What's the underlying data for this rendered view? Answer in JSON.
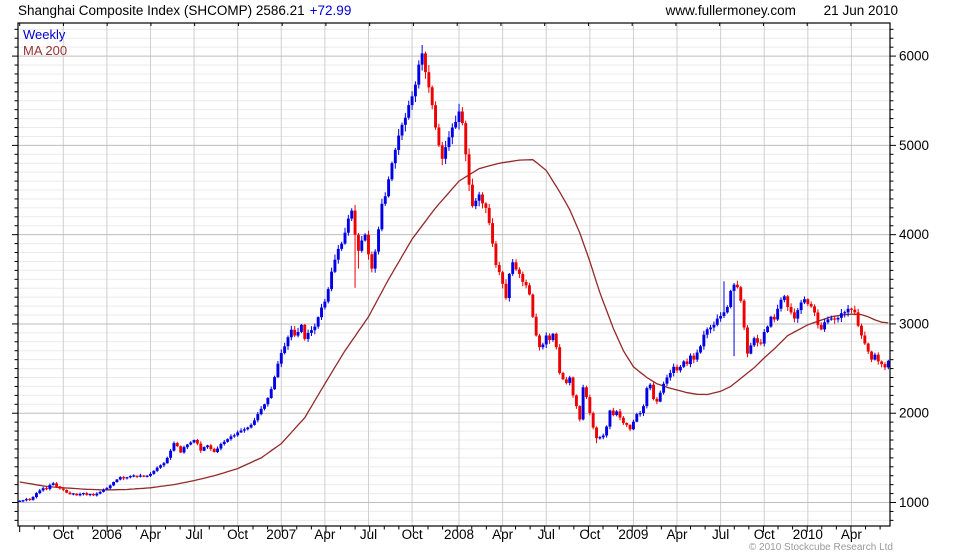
{
  "header": {
    "title_left": "Shanghai Composite Index (SHCOMP) 2586.21",
    "change": "+72.99",
    "website": "www.fullermoney.com",
    "date": "21 Jun 2010"
  },
  "legend": {
    "timeframe": "Weekly",
    "ma": "MA 200"
  },
  "footer": {
    "copyright": "© 2010 Stockcube Research Ltd"
  },
  "chart_data": {
    "type": "candlestick",
    "title": "Shanghai Composite Index (SHCOMP)",
    "timeframe": "Weekly",
    "overlay": "MA 200",
    "last_price": 2586.21,
    "change": 72.99,
    "grid": "on",
    "y_axis": {
      "side": "right",
      "min": 737,
      "max": 6370,
      "minor_step": 100,
      "ticks": [
        {
          "v": 1000,
          "label": "1000"
        },
        {
          "v": 2000,
          "label": "2000"
        },
        {
          "v": 3000,
          "label": "3000"
        },
        {
          "v": 4000,
          "label": "4000"
        },
        {
          "v": 5000,
          "label": "5000"
        },
        {
          "v": 6000,
          "label": "6000"
        }
      ]
    },
    "x_axis": {
      "unit": "week",
      "start": "Jul 2005",
      "end": "Jun 2010",
      "weeks_total": 260,
      "labels": [
        {
          "label": "Oct",
          "week": 13
        },
        {
          "label": "2006",
          "week": 26
        },
        {
          "label": "Apr",
          "week": 39
        },
        {
          "label": "Jul",
          "week": 52
        },
        {
          "label": "Oct",
          "week": 65
        },
        {
          "label": "2007",
          "week": 78
        },
        {
          "label": "Apr",
          "week": 91
        },
        {
          "label": "Jul",
          "week": 104
        },
        {
          "label": "Oct",
          "week": 117
        },
        {
          "label": "2008",
          "week": 131
        },
        {
          "label": "Apr",
          "week": 144
        },
        {
          "label": "Jul",
          "week": 157
        },
        {
          "label": "Oct",
          "week": 170
        },
        {
          "label": "2009",
          "week": 183
        },
        {
          "label": "Apr",
          "week": 196
        },
        {
          "label": "Jul",
          "week": 209
        },
        {
          "label": "Oct",
          "week": 222
        },
        {
          "label": "2010",
          "week": 235
        },
        {
          "label": "Apr",
          "week": 248
        }
      ]
    },
    "weekly_closes": [
      1012,
      1025,
      1038,
      1030,
      1060,
      1105,
      1135,
      1160,
      1150,
      1195,
      1215,
      1180,
      1155,
      1141,
      1110,
      1092,
      1100,
      1080,
      1095,
      1105,
      1085,
      1095,
      1080,
      1100,
      1120,
      1145,
      1161,
      1192,
      1230,
      1258,
      1285,
      1270,
      1283,
      1295,
      1299,
      1288,
      1302,
      1290,
      1298,
      1320,
      1355,
      1390,
      1417,
      1440,
      1500,
      1580,
      1665,
      1630,
      1560,
      1620,
      1650,
      1672,
      1700,
      1660,
      1580,
      1620,
      1640,
      1600,
      1565,
      1605,
      1655,
      1680,
      1710,
      1740,
      1752,
      1785,
      1805,
      1820,
      1840,
      1870,
      1920,
      1990,
      2050,
      2100,
      2170,
      2270,
      2405,
      2555,
      2675,
      2750,
      2850,
      2935,
      2870,
      2910,
      2990,
      2832,
      2900,
      2930,
      2970,
      3075,
      3184,
      3250,
      3390,
      3585,
      3720,
      3841,
      3900,
      4022,
      4180,
      4270,
      4000,
      3820,
      3935,
      4000,
      3780,
      3620,
      3810,
      4060,
      4346,
      4430,
      4620,
      4800,
      4950,
      5110,
      5230,
      5310,
      5450,
      5550,
      5680,
      5905,
      6030,
      5820,
      5650,
      5450,
      5200,
      5000,
      4850,
      4980,
      5090,
      5200,
      5262,
      5380,
      5250,
      4900,
      4560,
      4320,
      4380,
      4450,
      4350,
      4300,
      4130,
      3900,
      3660,
      3580,
      3450,
      3290,
      3560,
      3690,
      3610,
      3560,
      3470,
      3433,
      3330,
      3080,
      2870,
      2740,
      2770,
      2870,
      2820,
      2890,
      2740,
      2450,
      2380,
      2340,
      2400,
      2200,
      2080,
      1930,
      2290,
      2180,
      2000,
      1840,
      1720,
      1730,
      1750,
      1850,
      2030,
      1980,
      2020,
      1950,
      1890,
      1870,
      1820,
      1905,
      1990,
      2000,
      2080,
      2280,
      2320,
      2160,
      2130,
      2230,
      2330,
      2400,
      2450,
      2520,
      2480,
      2520,
      2580,
      2550,
      2645,
      2600,
      2680,
      2750,
      2880,
      2940,
      2960,
      2990,
      3060,
      3090,
      3130,
      3190,
      3370,
      3440,
      3412,
      3260,
      2960,
      2668,
      2760,
      2840,
      2790,
      2780,
      2910,
      2970,
      3080,
      3050,
      3170,
      3270,
      3310,
      3190,
      3130,
      3060,
      3155,
      3240,
      3277,
      3224,
      3196,
      3128,
      2989,
      2939,
      3018,
      3051,
      3060,
      3050,
      3068,
      3120,
      3130,
      3170,
      3160,
      3130,
      2980,
      2870,
      2780,
      2690,
      2600,
      2655,
      2580,
      2550,
      2513,
      2586
    ],
    "wick_overrides": {
      "100": {
        "low": 3404
      },
      "101": {
        "low": 3620
      },
      "120": {
        "high": 6124
      },
      "172": {
        "low": 1664
      },
      "210": {
        "high": 3478
      },
      "213": {
        "low": 2639
      }
    },
    "ma200_points": [
      [
        0,
        1230
      ],
      [
        8,
        1180
      ],
      [
        13,
        1165
      ],
      [
        20,
        1148
      ],
      [
        26,
        1140
      ],
      [
        32,
        1146
      ],
      [
        39,
        1165
      ],
      [
        46,
        1200
      ],
      [
        52,
        1245
      ],
      [
        58,
        1300
      ],
      [
        65,
        1380
      ],
      [
        72,
        1500
      ],
      [
        78,
        1660
      ],
      [
        85,
        1950
      ],
      [
        91,
        2330
      ],
      [
        97,
        2700
      ],
      [
        104,
        3080
      ],
      [
        110,
        3500
      ],
      [
        117,
        3950
      ],
      [
        124,
        4300
      ],
      [
        131,
        4600
      ],
      [
        137,
        4740
      ],
      [
        143,
        4800
      ],
      [
        149,
        4835
      ],
      [
        153,
        4840
      ],
      [
        157,
        4720
      ],
      [
        161,
        4480
      ],
      [
        164,
        4280
      ],
      [
        167,
        4020
      ],
      [
        170,
        3700
      ],
      [
        173,
        3350
      ],
      [
        177,
        2950
      ],
      [
        180,
        2700
      ],
      [
        183,
        2520
      ],
      [
        187,
        2400
      ],
      [
        190,
        2330
      ],
      [
        193,
        2290
      ],
      [
        196,
        2260
      ],
      [
        199,
        2230
      ],
      [
        202,
        2212
      ],
      [
        205,
        2210
      ],
      [
        209,
        2245
      ],
      [
        212,
        2300
      ],
      [
        216,
        2420
      ],
      [
        219,
        2510
      ],
      [
        222,
        2620
      ],
      [
        225,
        2720
      ],
      [
        229,
        2870
      ],
      [
        232,
        2930
      ],
      [
        235,
        2990
      ],
      [
        238,
        3030
      ],
      [
        242,
        3080
      ],
      [
        245,
        3100
      ],
      [
        248,
        3110
      ],
      [
        251,
        3105
      ],
      [
        253,
        3080
      ],
      [
        255,
        3045
      ],
      [
        257,
        3020
      ],
      [
        259,
        3012
      ]
    ],
    "colors": {
      "up": "#0000e6",
      "down": "#ee0000",
      "ma_line": "#932a2a",
      "grid_major": "#bdbdbd",
      "grid_minor": "#ebebeb",
      "grid_vertical": "#cfcfcf",
      "axis": "#000000",
      "change_text": "#0000d8",
      "legend_weekly": "#0000cc",
      "legend_ma": "#993333",
      "copyright": "#9a9a9a"
    }
  }
}
